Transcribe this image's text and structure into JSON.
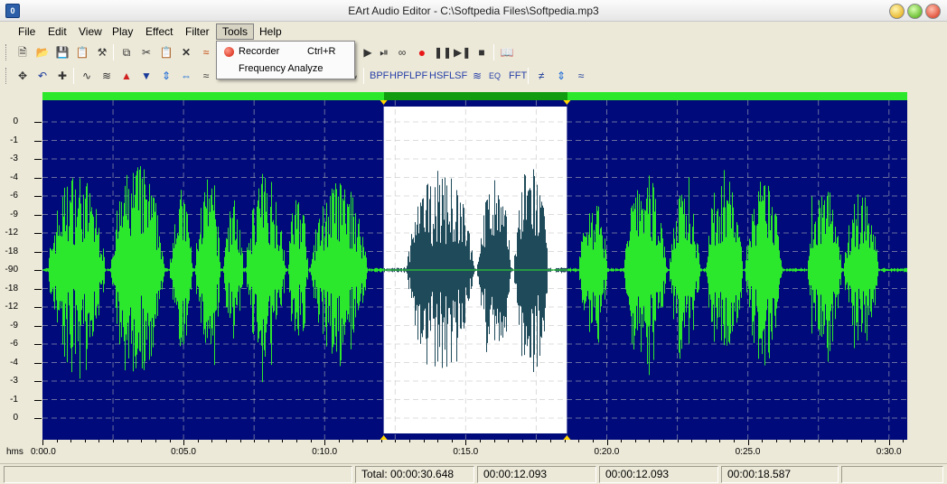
{
  "window": {
    "title": "EArt Audio Editor - C:\\Softpedia Files\\Softpedia.mp3",
    "icon_label": "0"
  },
  "menubar": {
    "items": [
      "File",
      "Edit",
      "View",
      "Play",
      "Effect",
      "Filter",
      "Tools",
      "Help"
    ],
    "active": "Tools"
  },
  "tools_menu": {
    "items": [
      {
        "label": "Recorder",
        "shortcut": "Ctrl+R",
        "icon": "record-icon"
      },
      {
        "label": "Frequency Analyze",
        "shortcut": ""
      }
    ]
  },
  "toolbar2_text_buttons": [
    "BPF",
    "HPF",
    "LPF",
    "HSF",
    "LSF",
    "EQ",
    "FFT"
  ],
  "waveform": {
    "colors": {
      "background": "#000a7a",
      "wave": "#2ce82c",
      "selection_background": "#ffffff",
      "selection_wave": "#1f4a5a",
      "overview": "#2ce82c",
      "overview_selection": "#119b11",
      "grid": "#c0c0c0",
      "marker": "#ffd400"
    },
    "total_seconds": 30.648,
    "selection": {
      "start_seconds": 12.093,
      "end_seconds": 18.587
    },
    "y_labels": [
      "0",
      "-1",
      "-3",
      "-4",
      "-6",
      "-9",
      "-12",
      "-18",
      "-90",
      "-18",
      "-12",
      "-9",
      "-6",
      "-4",
      "-3",
      "-1",
      "0"
    ],
    "x_labels": [
      {
        "t": 0,
        "label": "0:00.0"
      },
      {
        "t": 5,
        "label": "0:05.0"
      },
      {
        "t": 10,
        "label": "0:10.0"
      },
      {
        "t": 15,
        "label": "0:15.0"
      },
      {
        "t": 20,
        "label": "0:20.0"
      },
      {
        "t": 25,
        "label": "0:25.0"
      },
      {
        "t": 30,
        "label": "0:30.0"
      }
    ],
    "x_unit_label": "hms"
  },
  "statusbar": {
    "total": "Total: 00:00:30.648",
    "selection_start": "00:00:12.093",
    "selection_end": "00:00:12.093",
    "selection_length": "00:00:18.587"
  }
}
